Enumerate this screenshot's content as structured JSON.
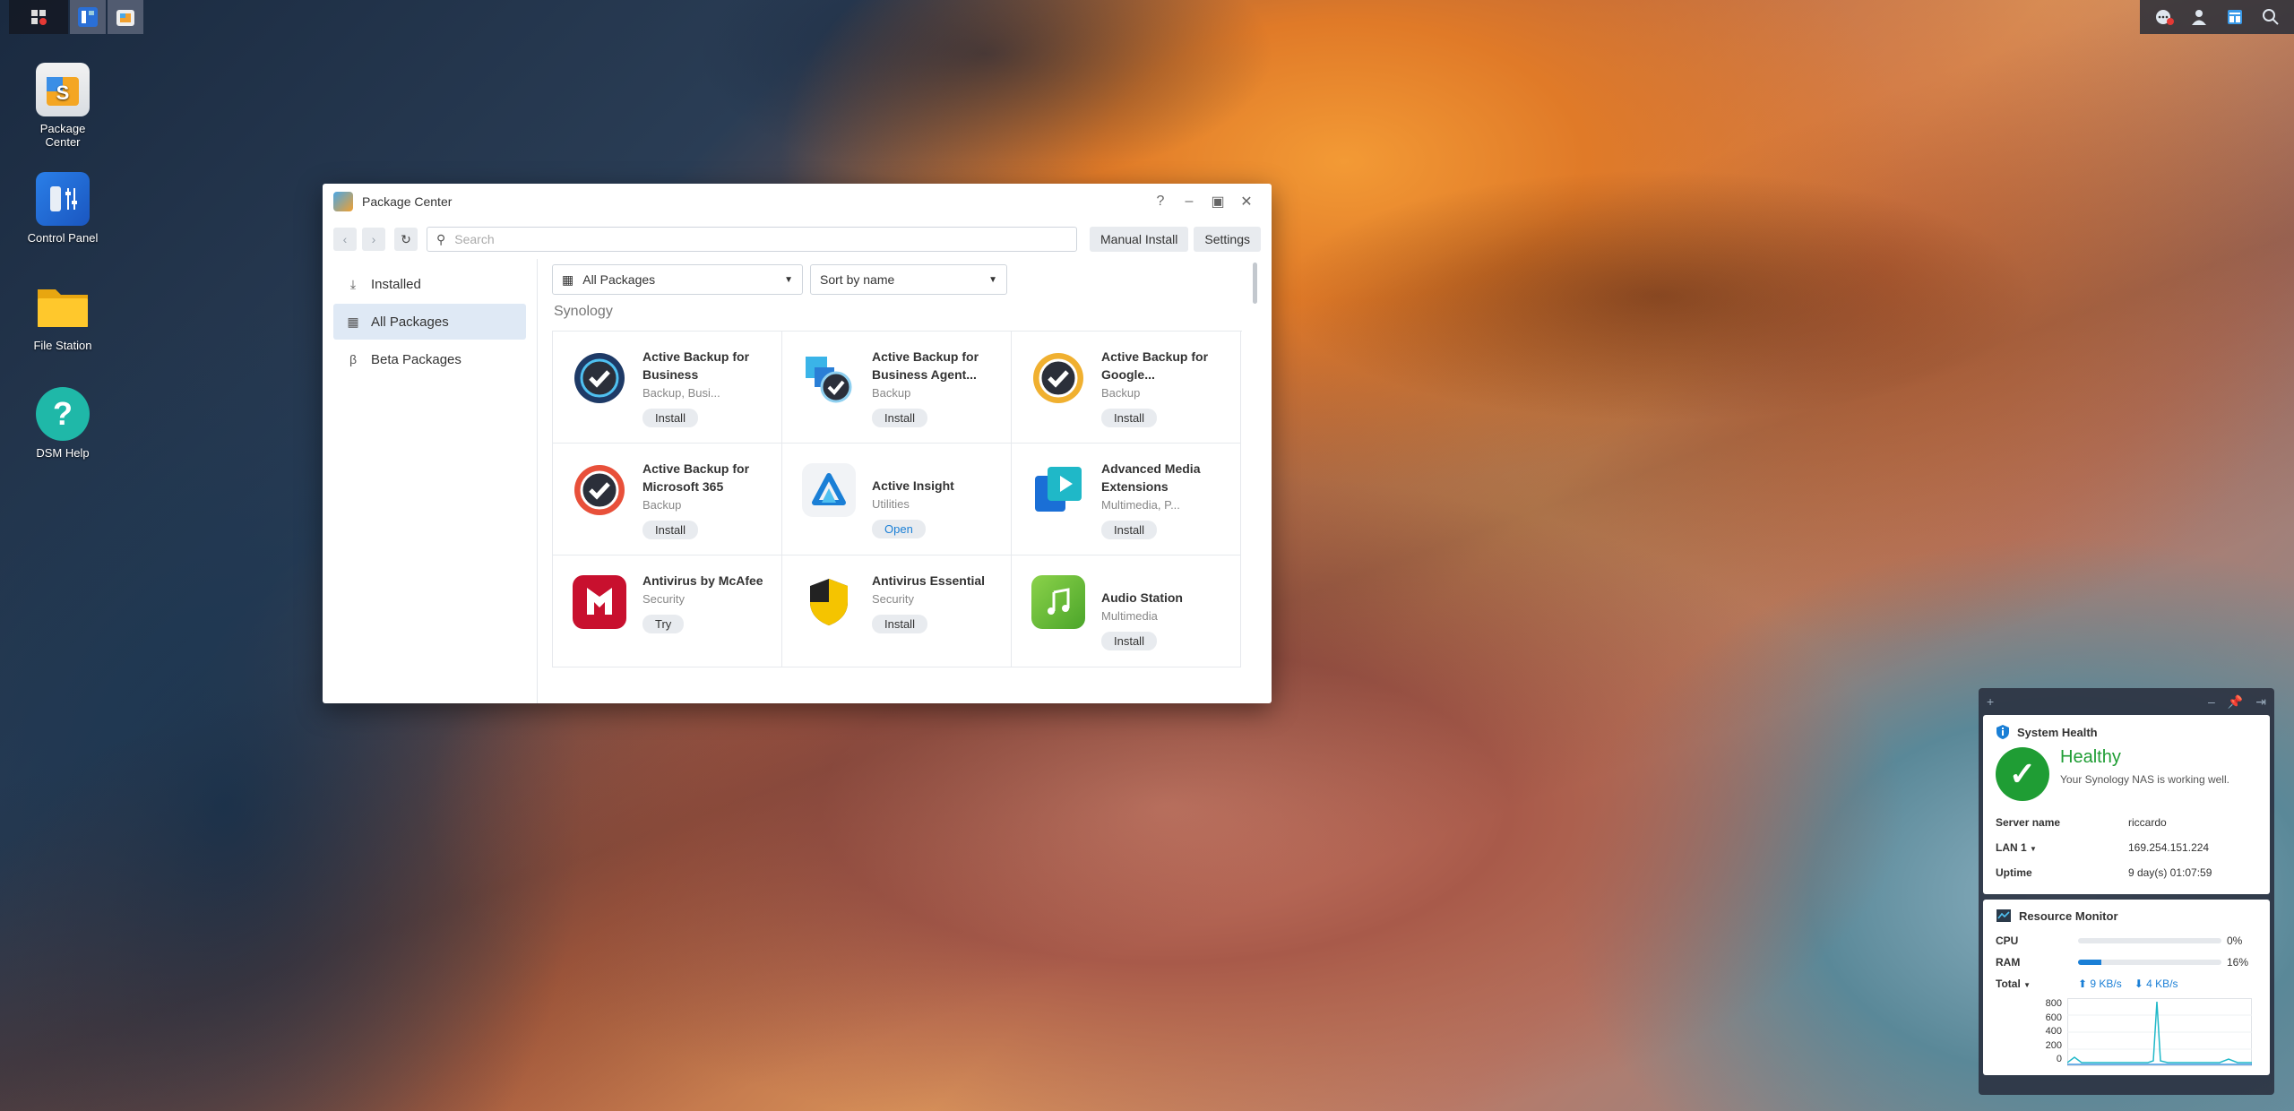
{
  "desktop": {
    "icons": [
      {
        "label": "Package\nCenter"
      },
      {
        "label": "Control Panel"
      },
      {
        "label": "File Station"
      },
      {
        "label": "DSM Help"
      }
    ]
  },
  "window": {
    "title": "Package Center",
    "search_placeholder": "Search",
    "manual_install": "Manual Install",
    "settings": "Settings",
    "sidebar": [
      {
        "label": "Installed"
      },
      {
        "label": "All Packages"
      },
      {
        "label": "Beta Packages"
      }
    ],
    "filter_category": "All Packages",
    "filter_sort": "Sort by name",
    "section": "Synology",
    "packages": [
      {
        "name": "Active Backup for Business",
        "category": "Backup, Busi...",
        "action": "Install"
      },
      {
        "name": "Active Backup for Business Agent...",
        "category": "Backup",
        "action": "Install"
      },
      {
        "name": "Active Backup for Google...",
        "category": "Backup",
        "action": "Install"
      },
      {
        "name": "Active Backup for Microsoft 365",
        "category": "Backup",
        "action": "Install"
      },
      {
        "name": "Active Insight",
        "category": "Utilities",
        "action": "Open"
      },
      {
        "name": "Advanced Media Extensions",
        "category": "Multimedia, P...",
        "action": "Install"
      },
      {
        "name": "Antivirus by McAfee",
        "category": "Security",
        "action": "Try"
      },
      {
        "name": "Antivirus Essential",
        "category": "Security",
        "action": "Install"
      },
      {
        "name": "Audio Station",
        "category": "Multimedia",
        "action": "Install"
      }
    ]
  },
  "system_health": {
    "title": "System Health",
    "status": "Healthy",
    "description": "Your Synology NAS is working well.",
    "server_name_label": "Server name",
    "server_name": "riccardo",
    "lan_label": "LAN 1",
    "lan_ip": "169.254.151.224",
    "uptime_label": "Uptime",
    "uptime": "9 day(s) 01:07:59"
  },
  "resource_monitor": {
    "title": "Resource Monitor",
    "cpu_label": "CPU",
    "cpu": "0%",
    "cpu_fraction": 0.0,
    "ram_label": "RAM",
    "ram": "16%",
    "ram_fraction": 0.16,
    "total_label": "Total",
    "upload": "9 KB/s",
    "download": "4 KB/s",
    "y_ticks": [
      "800",
      "600",
      "400",
      "200",
      "0"
    ]
  },
  "colors": {
    "accent": "#1a7fd6",
    "healthy": "#1f9d34"
  }
}
